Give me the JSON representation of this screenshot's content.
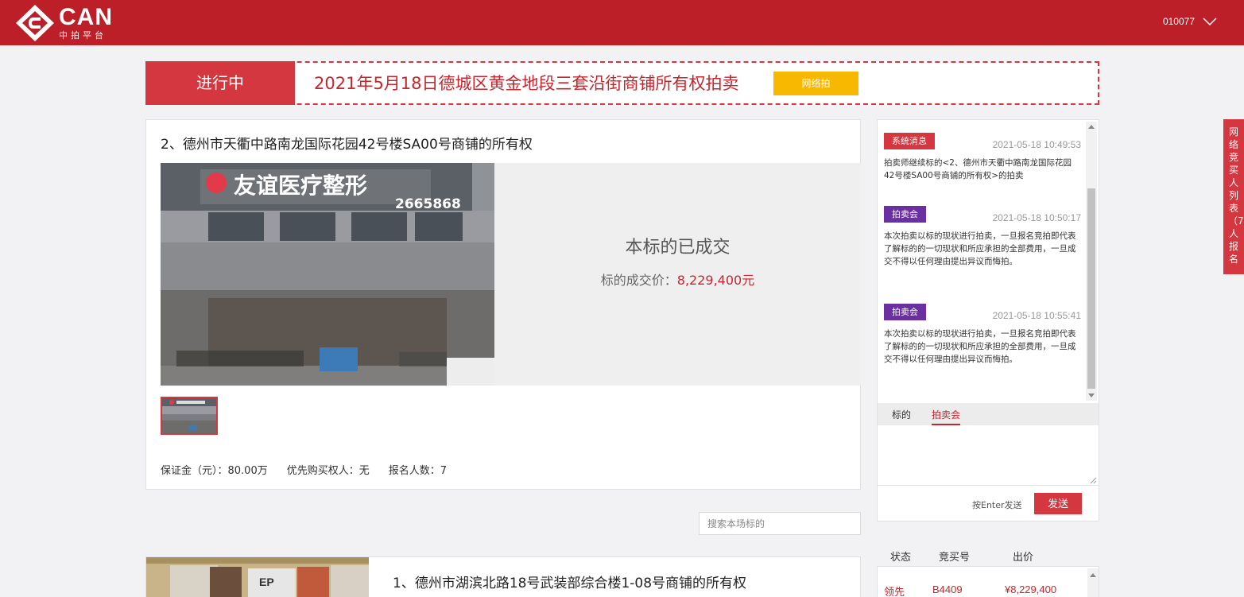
{
  "header": {
    "logo_text": "CAN",
    "logo_sub": "中拍平台",
    "user_id": "010077"
  },
  "banner": {
    "status": "进行中",
    "title": "2021年5月18日德城区黄金地段三套沿街商铺所有权拍卖",
    "badge": "网络拍"
  },
  "lot": {
    "title": "2、德州市天衢中路南龙国际花园42号楼SA00号商铺的所有权",
    "sold_title": "本标的已成交",
    "sold_price_label": "标的成交价：",
    "sold_price_value": "8,229,400元",
    "deposit": "保证金（元）：80.00万",
    "priority": "优先购买权人：无",
    "signups": "报名人数：7"
  },
  "search": {
    "placeholder": "搜索本场标的"
  },
  "lot2": {
    "title": "1、德州市湖滨北路18号武装部综合楼1-08号商铺的所有权"
  },
  "chat": {
    "messages": [
      {
        "tag": "系统消息",
        "time": "2021-05-18 10:49:53",
        "body": "拍卖师继续标的<2、德州市天衢中路南龙国际花园42号楼SA00号商铺的所有权>的拍卖"
      },
      {
        "tag": "拍卖会",
        "time": "2021-05-18 10:50:17",
        "body": "本次拍卖以标的现状进行拍卖，一旦报名竞拍即代表了解标的的一切现状和所应承担的全部费用，一旦成交不得以任何理由提出异议而悔拍。"
      },
      {
        "tag": "拍卖会",
        "time": "2021-05-18 10:55:41",
        "body": "本次拍卖以标的现状进行拍卖，一旦报名竞拍即代表了解标的的一切现状和所应承担的全部费用，一旦成交不得以任何理由提出异议而悔拍。"
      }
    ],
    "tabs": [
      "标的",
      "拍卖会"
    ],
    "active_tab": "拍卖会",
    "enter_hint": "按Enter发送",
    "send_label": "发送"
  },
  "bids": {
    "headers": [
      "状态",
      "竞买号",
      "出价"
    ],
    "rows": [
      {
        "status": "领先",
        "bidder": "B4409",
        "price": "¥8,229,400"
      }
    ]
  },
  "side_tab": {
    "label": "网络竞买人列表（7）人报名"
  },
  "colors": {
    "brand_red": "#bd1f29",
    "accent_red": "#d4373f",
    "badge_yellow": "#f9b800",
    "auction_purple": "#6a2fa0"
  },
  "icons": [
    "logo-mark-icon",
    "chevron-down-icon",
    "scroll-up-icon",
    "scroll-down-icon",
    "resize-grip-icon"
  ]
}
